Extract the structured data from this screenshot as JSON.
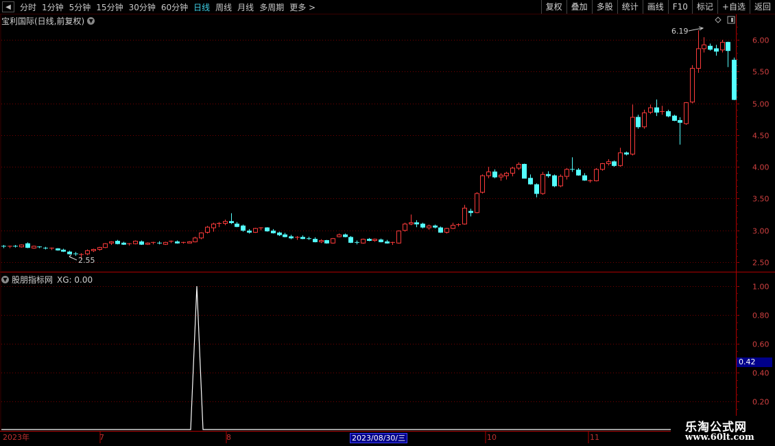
{
  "toolbar": {
    "back_icon": "back-arrow-icon",
    "periods": [
      "分时",
      "1分钟",
      "5分钟",
      "15分钟",
      "30分钟",
      "60分钟",
      "日线",
      "周线",
      "月线",
      "多周期",
      "更多 >"
    ],
    "active_period": "日线",
    "right_buttons": [
      "复权",
      "叠加",
      "多股",
      "统计",
      "画线",
      "F10",
      "标记",
      "+自选",
      "返回"
    ]
  },
  "main_panel": {
    "title": "宝利国际(日线,前复权)",
    "axis_labels": [
      "6.00",
      "5.50",
      "5.00",
      "4.50",
      "4.00",
      "3.50",
      "3.00",
      "2.50"
    ],
    "high_label": "6.19",
    "low_label": "2.55",
    "up_color": "#ff3b3b",
    "down_color": "#54ffff",
    "grid_color": "#7a0000"
  },
  "indicator_panel": {
    "title": "股朋指标网",
    "series_label": "XG: 0.00",
    "axis_labels": [
      "1.00",
      "0.80",
      "0.60",
      "0.40",
      "0.20"
    ],
    "current_value": "0.42"
  },
  "time_axis": {
    "labels": [
      "2023年",
      "7",
      "8",
      "10",
      "11"
    ],
    "cursor_date": "2023/08/30/三"
  },
  "watermark": {
    "line1": "乐淘公式网",
    "line2": "www.60lt.com"
  }
}
